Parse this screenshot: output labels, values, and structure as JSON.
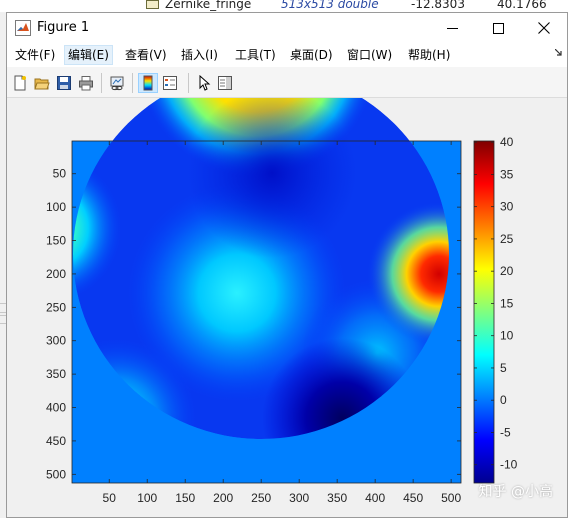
{
  "background_app": {
    "var_name": "Zernike_fringe",
    "var_type": "513x513 double",
    "var_min": "-12.8303",
    "var_max": "40.1766"
  },
  "window": {
    "title": "Figure 1",
    "minimize_icon": "minimize-icon",
    "maximize_icon": "maximize-icon",
    "close_icon": "close-icon"
  },
  "menu": {
    "items": [
      "文件(F)",
      "编辑(E)",
      "查看(V)",
      "插入(I)",
      "工具(T)",
      "桌面(D)",
      "窗口(W)",
      "帮助(H)"
    ],
    "active_index": 1,
    "corner_icon": "dock-arrow-icon"
  },
  "toolbar": {
    "buttons": [
      "new-figure-icon",
      "open-file-icon",
      "save-icon",
      "print-icon",
      "link-plot-icon",
      "colorbar-icon",
      "legend-icon",
      "pointer-icon",
      "property-inspector-icon"
    ],
    "active_button": "colorbar-icon"
  },
  "chart_data": {
    "type": "heatmap",
    "colormap": "jet",
    "x_ticks": [
      50,
      100,
      150,
      200,
      250,
      300,
      350,
      400,
      450,
      500
    ],
    "y_ticks": [
      50,
      100,
      150,
      200,
      250,
      300,
      350,
      400,
      450,
      500
    ],
    "xlim": [
      1,
      513
    ],
    "ylim": [
      1,
      513
    ],
    "y_direction": "reverse",
    "colorbar_ticks": [
      -10,
      -5,
      0,
      5,
      10,
      15,
      20,
      25,
      30,
      35,
      40
    ],
    "clim": [
      -12.8303,
      40.1766
    ],
    "outside_value": 0
  },
  "watermark": "知乎 @小高"
}
